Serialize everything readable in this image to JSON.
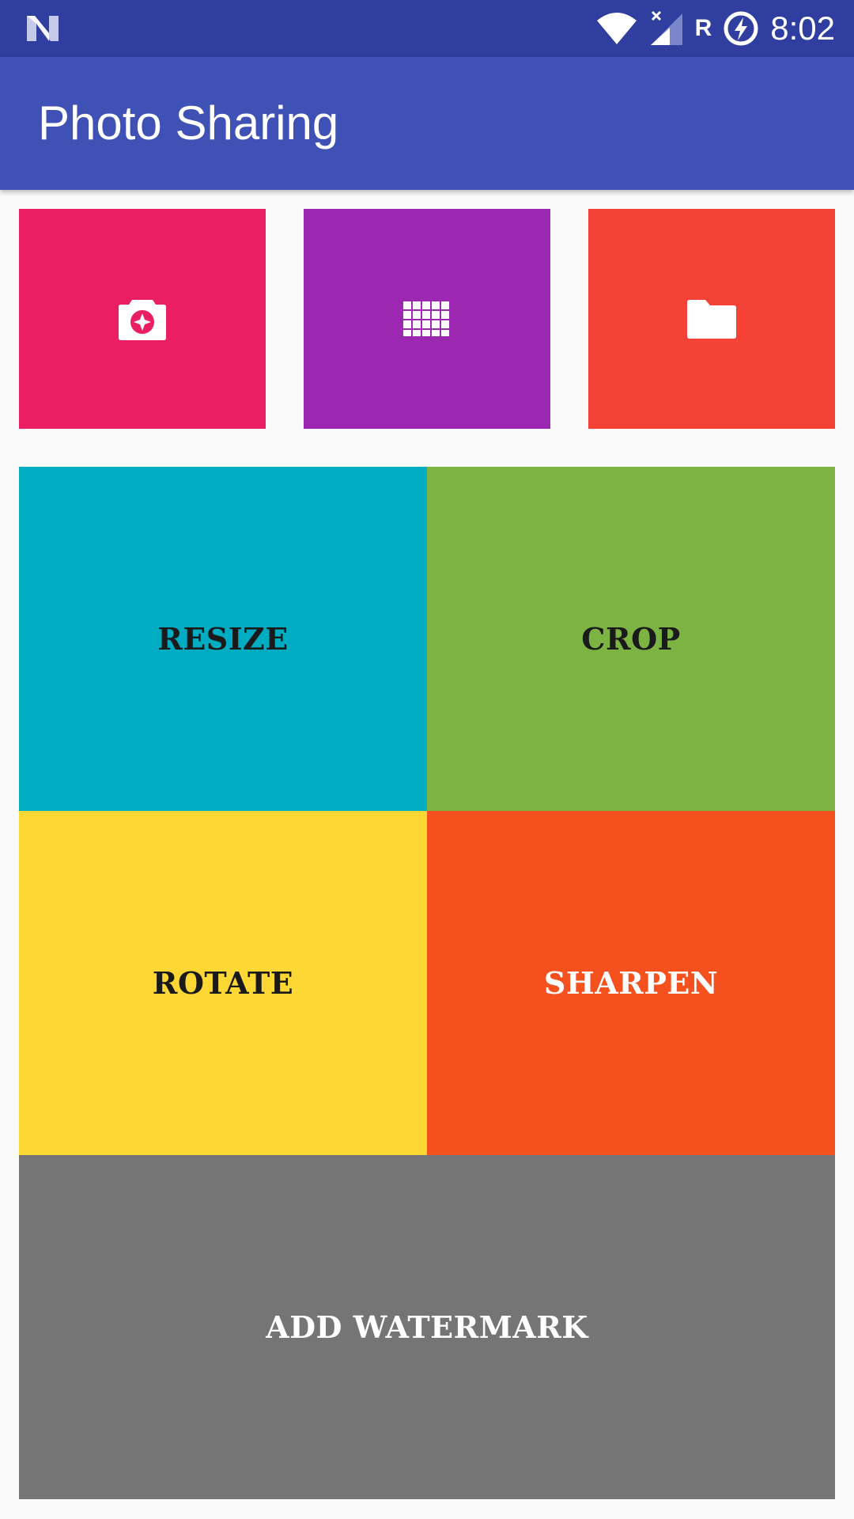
{
  "status_bar": {
    "time": "8:02",
    "roaming": "R",
    "icons": [
      "notification-n-icon",
      "wifi-icon",
      "signal-icon",
      "battery-saver-icon"
    ]
  },
  "app_bar": {
    "title": "Photo Sharing"
  },
  "quick_actions": [
    {
      "icon": "camera-icon",
      "color": "#e91e63"
    },
    {
      "icon": "gallery-grid-icon",
      "color": "#9c27b0"
    },
    {
      "icon": "folder-icon",
      "color": "#f44336"
    }
  ],
  "actions": {
    "resize": "RESIZE",
    "crop": "CROP",
    "rotate": "ROTATE",
    "sharpen": "SHARPEN",
    "watermark": "ADD WATERMARK"
  },
  "colors": {
    "status_bar": "#303f9f",
    "app_bar": "#3f51b5",
    "resize": "#00acc1",
    "crop": "#7cb342",
    "rotate": "#fdd835",
    "sharpen": "#f4511e",
    "watermark": "#757575",
    "background": "#fafafa"
  }
}
